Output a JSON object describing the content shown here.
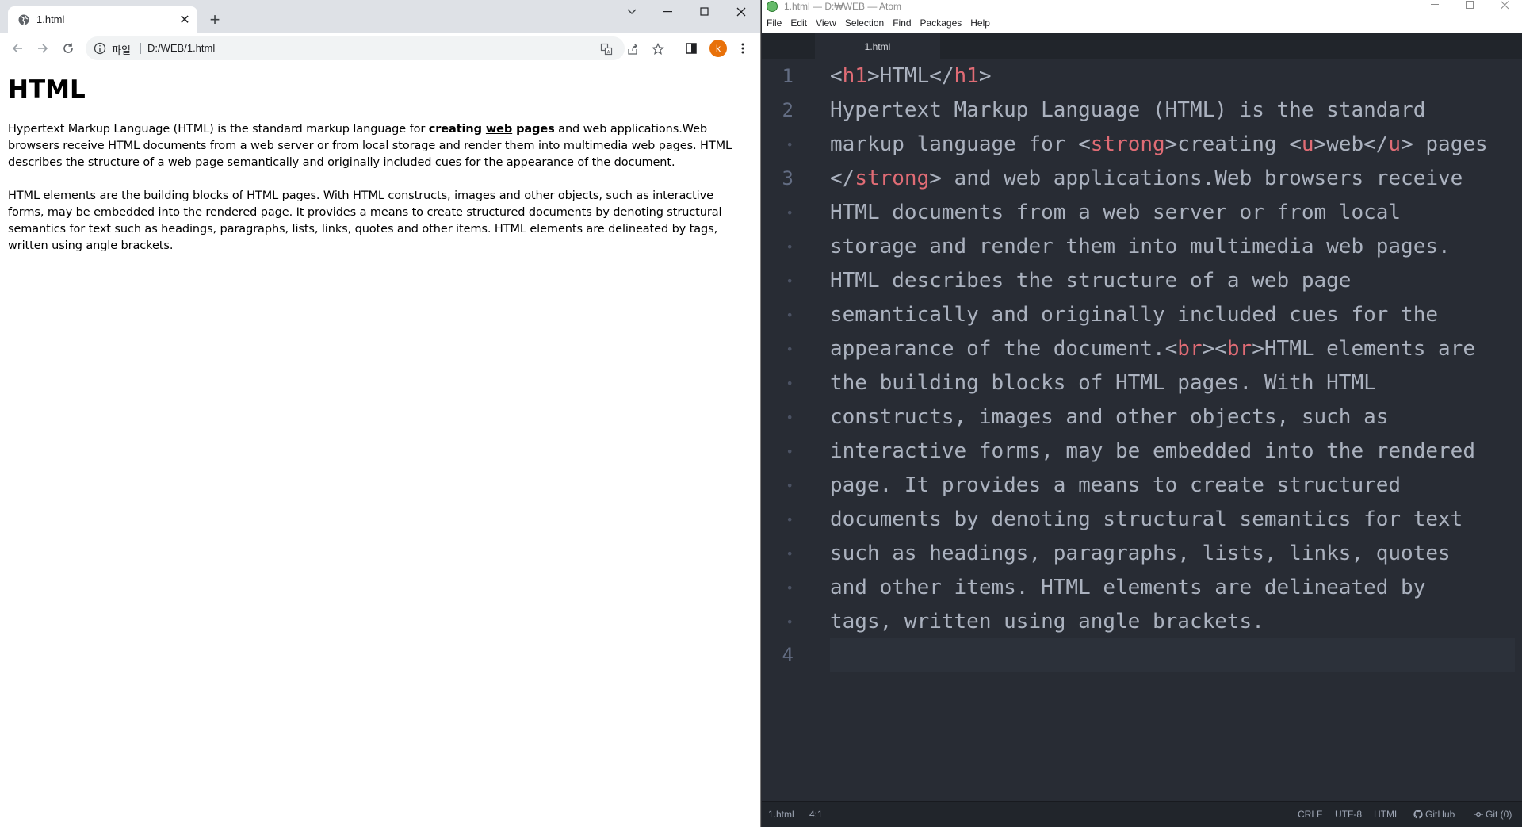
{
  "chrome": {
    "tab_title": "1.html",
    "url_scheme_label": "파일",
    "url": "D:/WEB/1.html",
    "avatar_letter": "k",
    "page": {
      "heading": "HTML",
      "p1_before": "Hypertext Markup Language (HTML) is the standard markup language for ",
      "p1_strong_1": "creating ",
      "p1_underlined": "web",
      "p1_strong_2": " pages",
      "p1_after": " and web applications.Web browsers receive HTML documents from a web server or from local storage and render them into multimedia web pages. HTML describes the structure of a web page semantically and originally included cues for the appearance of the document.",
      "p2": "HTML elements are the building blocks of HTML pages. With HTML constructs, images and other objects, such as interactive forms, may be embedded into the rendered page. It provides a means to create structured documents by denoting structural semantics for text such as headings, paragraphs, lists, links, quotes and other items. HTML elements are delineated by tags, written using angle brackets."
    }
  },
  "atom": {
    "window_title": "1.html — D:₩WEB — Atom",
    "menu": [
      "File",
      "Edit",
      "View",
      "Selection",
      "Find",
      "Packages",
      "Help"
    ],
    "tab_title": "1.html",
    "gutter": [
      "1",
      "2",
      "•",
      "3",
      "•",
      "•",
      "•",
      "•",
      "•",
      "•",
      "•",
      "•",
      "•",
      "•",
      "•",
      "•",
      "•",
      "4"
    ],
    "lines": {
      "l0_a": "<",
      "l0_t1": "h1",
      "l0_b": ">HTML</",
      "l0_t2": "h1",
      "l0_c": ">",
      "l1": "Hypertext Markup Language (HTML) is the standard",
      "l2_a": "markup language for <",
      "l2_t1": "strong",
      "l2_b": ">creating <",
      "l2_t2": "u",
      "l2_c": ">web</",
      "l2_t3": "u",
      "l2_d": "> pages",
      "l3_a": "</",
      "l3_t1": "strong",
      "l3_b": "> and web applications.Web browsers receive",
      "l4": "HTML documents from a web server or from local",
      "l5": "storage and render them into multimedia web pages.",
      "l6": "HTML describes the structure of a web page",
      "l7": "semantically and originally included cues for the",
      "l8_a": "appearance of the document.<",
      "l8_t1": "br",
      "l8_b": "><",
      "l8_t2": "br",
      "l8_c": ">HTML elements are",
      "l9": "the building blocks of HTML pages. With HTML",
      "l10": "constructs, images and other objects, such as",
      "l11": "interactive forms, may be embedded into the rendered",
      "l12": "page. It provides a means to create structured",
      "l13": "documents by denoting structural semantics for text",
      "l14": "such as headings, paragraphs, lists, links, quotes",
      "l15": "and other items. HTML elements are delineated by",
      "l16": "tags, written using angle brackets."
    },
    "status": {
      "file": "1.html",
      "cursor": "4:1",
      "line_ending": "CRLF",
      "encoding": "UTF-8",
      "grammar": "HTML",
      "github": "GitHub",
      "git": "Git (0)"
    }
  }
}
